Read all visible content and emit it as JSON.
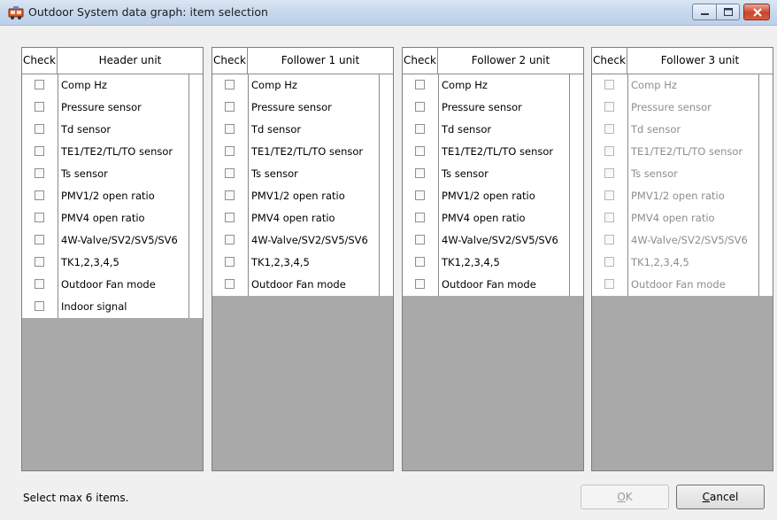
{
  "window": {
    "title": "Outdoor System data graph: item selection"
  },
  "panels": [
    {
      "check_label": "Check",
      "unit_label": "Header unit",
      "enabled": true,
      "items": [
        "Comp Hz",
        "Pressure sensor",
        "Td sensor",
        "TE1/TE2/TL/TO sensor",
        "Ts sensor",
        "PMV1/2 open ratio",
        "PMV4 open ratio",
        "4W-Valve/SV2/SV5/SV6",
        "TK1,2,3,4,5",
        "Outdoor Fan mode",
        "Indoor signal"
      ]
    },
    {
      "check_label": "Check",
      "unit_label": "Follower 1 unit",
      "enabled": true,
      "items": [
        "Comp Hz",
        "Pressure sensor",
        "Td sensor",
        "TE1/TE2/TL/TO sensor",
        "Ts sensor",
        "PMV1/2 open ratio",
        "PMV4 open ratio",
        "4W-Valve/SV2/SV5/SV6",
        "TK1,2,3,4,5",
        "Outdoor Fan mode"
      ]
    },
    {
      "check_label": "Check",
      "unit_label": "Follower 2 unit",
      "enabled": true,
      "items": [
        "Comp Hz",
        "Pressure sensor",
        "Td sensor",
        "TE1/TE2/TL/TO sensor",
        "Ts sensor",
        "PMV1/2 open ratio",
        "PMV4 open ratio",
        "4W-Valve/SV2/SV5/SV6",
        "TK1,2,3,4,5",
        "Outdoor Fan mode"
      ]
    },
    {
      "check_label": "Check",
      "unit_label": "Follower 3 unit",
      "enabled": false,
      "items": [
        "Comp Hz",
        "Pressure sensor",
        "Td sensor",
        "TE1/TE2/TL/TO sensor",
        "Ts sensor",
        "PMV1/2 open ratio",
        "PMV4 open ratio",
        "4W-Valve/SV2/SV5/SV6",
        "TK1,2,3,4,5",
        "Outdoor Fan mode"
      ]
    }
  ],
  "footer": {
    "status": "Select max 6 items.",
    "ok_label_mnemonic": "O",
    "ok_label_rest": "K",
    "cancel_label_mnemonic": "C",
    "cancel_label_rest": "ancel"
  }
}
